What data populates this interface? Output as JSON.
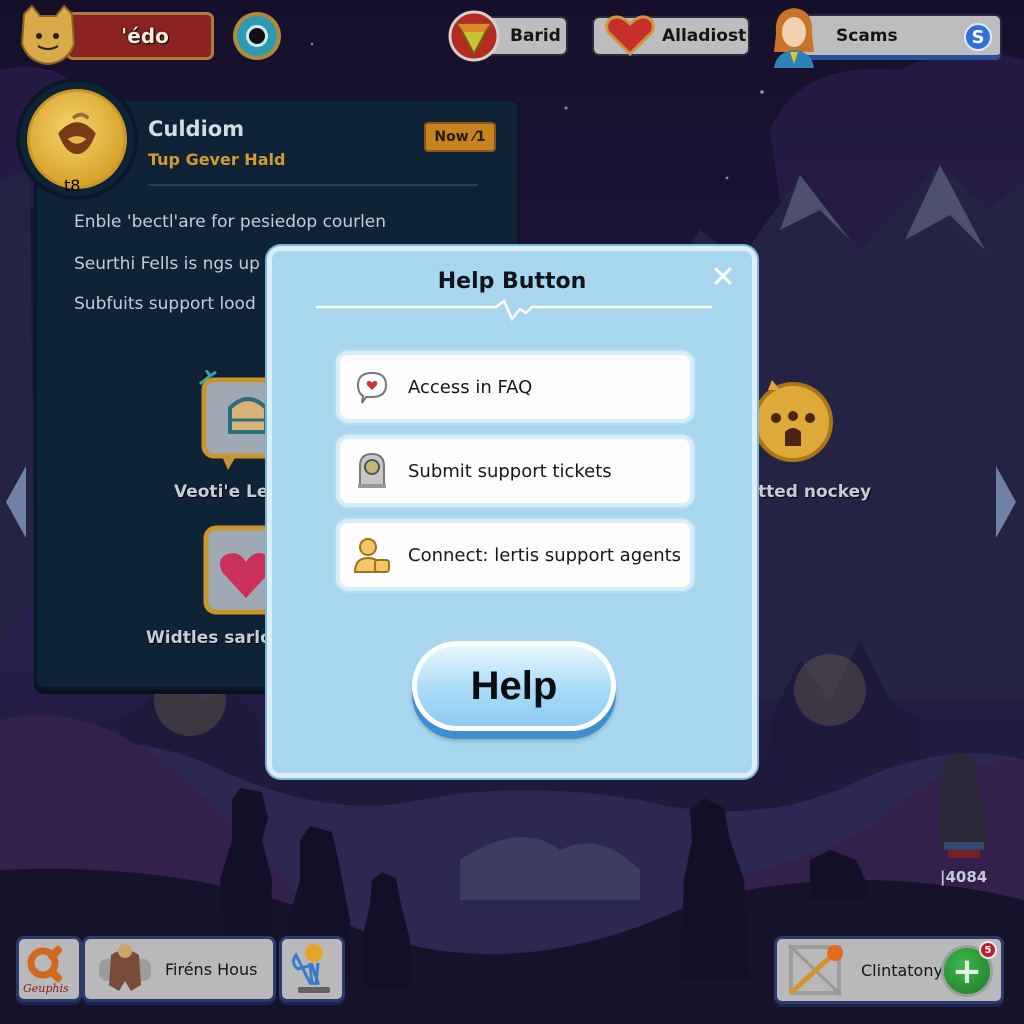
{
  "topbar": {
    "player_name": "'édo",
    "resources": [
      {
        "label": "Barid",
        "icon": "triangle-gem-icon"
      },
      {
        "label": "Alladiost",
        "icon": "heart-icon"
      },
      {
        "label": "Scams",
        "icon": "s-coin-icon",
        "coin_letter": "S"
      }
    ],
    "eye_button_icon": "eye-icon"
  },
  "info_panel": {
    "title": "Culdiom",
    "subtitle": "Tup Gever Hald",
    "level_badge": "t8",
    "now_button": "Now ⁄1",
    "lines": [
      "Enble 'bectl'are for pesiedop courlen",
      "Seurthi Fells is ngs up",
      "Subfuits support lood"
    ],
    "features": [
      {
        "label": "Veoti'e Les",
        "icon": "chat-chest-icon"
      },
      {
        "label": "Widtles sarlo",
        "icon": "heart-frame-icon"
      }
    ]
  },
  "right_feature": {
    "label": "tted nockey",
    "icon": "surprised-face-icon"
  },
  "score": "|4084",
  "modal": {
    "title": "Help Button",
    "close_label": "✕",
    "options": [
      {
        "label": "Access in FAQ",
        "icon": "chat-heart-icon"
      },
      {
        "label": "Submit support tickets",
        "icon": "ticket-machine-icon"
      },
      {
        "label": "Connect: lertis support agents",
        "icon": "agent-icon"
      }
    ],
    "help_button": "Help"
  },
  "bottombar": {
    "graphics_label": "Geuphis",
    "friends_label": "Firéns Hous",
    "right_label": "Clintatony",
    "notification_count": "5",
    "plus_label": "+"
  },
  "colors": {
    "modal_bg": "#a7d6ee",
    "panel_bg": "#0f2337",
    "accent_gold": "#d69a33",
    "name_red": "#8b2323",
    "plus_green": "#2e9a3a"
  }
}
